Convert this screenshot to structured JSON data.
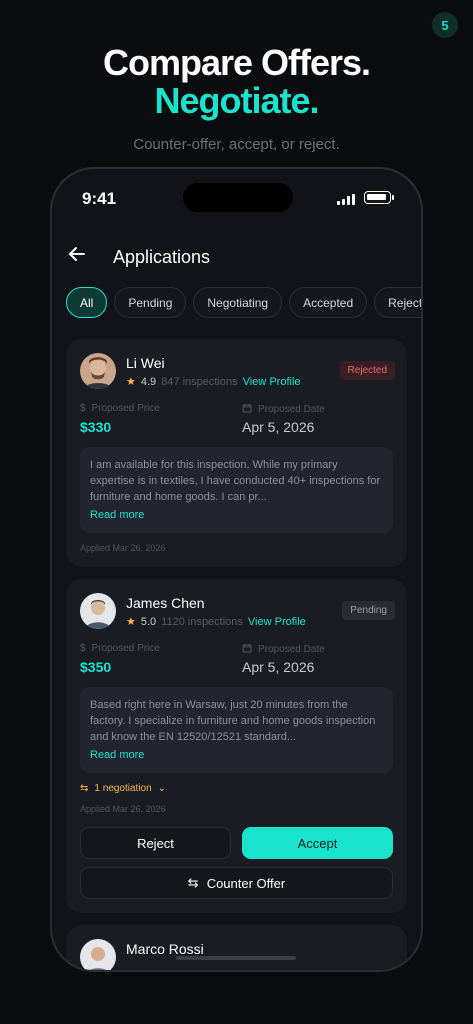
{
  "corner_badge": "5",
  "hero": {
    "title": "Compare Offers.",
    "accent": "Negotiate.",
    "subtitle": "Counter-offer, accept, or reject."
  },
  "status_bar": {
    "time": "9:41"
  },
  "header": {
    "title": "Applications",
    "back_icon": "arrow-left-icon"
  },
  "filters": [
    "All",
    "Pending",
    "Negotiating",
    "Accepted",
    "Rejected"
  ],
  "active_filter": "All",
  "colors": {
    "accent": "#19e3cd",
    "background": "#0b0c10",
    "card": "#1a1c24",
    "warning": "#f5b94a",
    "danger": "#e4676c"
  },
  "labels": {
    "proposed_price": "Proposed Price",
    "proposed_date": "Proposed Date",
    "read_more": "Read more",
    "view_profile": "View Profile",
    "reject": "Reject",
    "accept": "Accept",
    "counter_offer": "Counter Offer"
  },
  "applications": [
    {
      "name": "Li Wei",
      "rating": "4.9",
      "inspections": "847 inspections",
      "status": "Rejected",
      "price": "$330",
      "date": "Apr 5, 2026",
      "message": "I am available for this inspection. While my primary expertise is in textiles, I have conducted 40+ inspections for furniture and home goods. I can pr...",
      "applied": "Applied Mar 26, 2026"
    },
    {
      "name": "James Chen",
      "rating": "5.0",
      "inspections": "1120 inspections",
      "status": "Pending",
      "price": "$350",
      "date": "Apr 5, 2026",
      "message": "Based right here in Warsaw, just 20 minutes from the factory. I specialize in furniture and home goods inspection and know the EN 12520/12521 standard...",
      "negotiation": "1 negotiation",
      "applied": "Applied Mar 26, 2026"
    },
    {
      "name": "Marco Rossi"
    }
  ]
}
